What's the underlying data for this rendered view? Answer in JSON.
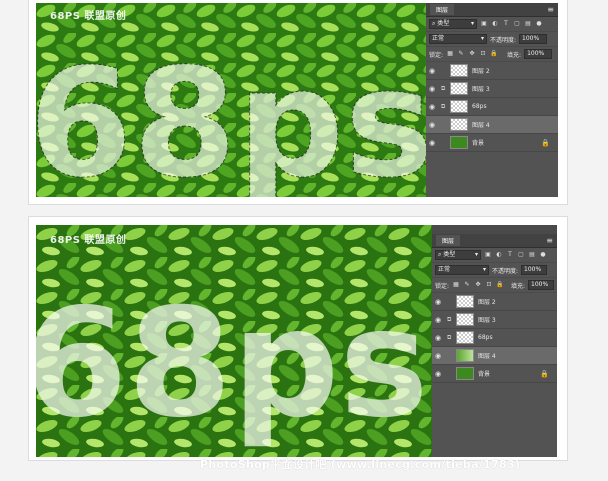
{
  "screens": [
    {
      "id": "top",
      "watermark": "68PS 联盟原创",
      "big_text": "68ps",
      "panel": {
        "tab": "图层",
        "filter_label": "类型",
        "blend_mode": "正常",
        "opacity_label": "不透明度:",
        "opacity_value": "100%",
        "lock_label": "锁定:",
        "fill_label": "填充:",
        "fill_value": "100%",
        "layers": [
          {
            "name": "图层 2",
            "thumb": "checker",
            "link": false,
            "active": false,
            "lock": false
          },
          {
            "name": "图层 3",
            "thumb": "checker",
            "link": true,
            "active": false,
            "lock": false
          },
          {
            "name": "68ps",
            "thumb": "checker",
            "link": true,
            "active": false,
            "lock": false
          },
          {
            "name": "图层 4",
            "thumb": "checker",
            "link": false,
            "active": true,
            "lock": false
          },
          {
            "name": "背景",
            "thumb": "green",
            "link": false,
            "active": false,
            "lock": true
          }
        ]
      }
    },
    {
      "id": "bottom",
      "watermark": "68PS 联盟原创",
      "big_text": "68ps",
      "panel": {
        "tab": "图层",
        "filter_label": "类型",
        "blend_mode": "正常",
        "opacity_label": "不透明度:",
        "opacity_value": "100%",
        "lock_label": "锁定:",
        "fill_label": "填充:",
        "fill_value": "100%",
        "layers": [
          {
            "name": "图层 2",
            "thumb": "checker",
            "link": false,
            "active": false,
            "lock": false
          },
          {
            "name": "图层 3",
            "thumb": "checker",
            "link": true,
            "active": false,
            "lock": false
          },
          {
            "name": "68ps",
            "thumb": "checker",
            "link": true,
            "active": false,
            "lock": false
          },
          {
            "name": "图层 4",
            "thumb": "greenish",
            "link": false,
            "active": true,
            "lock": false
          },
          {
            "name": "背景",
            "thumb": "green",
            "link": false,
            "active": false,
            "lock": true
          }
        ]
      }
    }
  ],
  "footer_watermark": "PhotoShop平面设计吧 (www.linecg.com/tieba/1783)",
  "colors": {
    "panel_bg": "#535353",
    "leaf_dark": "#2f7d14",
    "leaf_light": "#8fd24a",
    "text_white": "#fbfdf6"
  }
}
